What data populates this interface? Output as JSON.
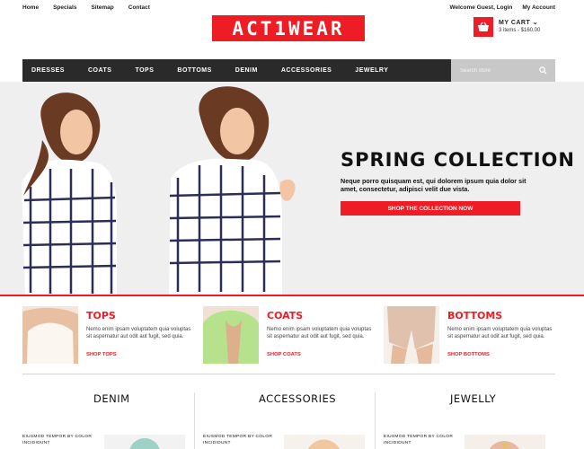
{
  "header": {
    "links": [
      "Home",
      "Specials",
      "Sitemap",
      "Contact"
    ],
    "account": [
      "Welcome Guest, Login",
      "My Account"
    ],
    "logo": "ACT1WEAR",
    "cart": {
      "title": "MY CART",
      "summary": "3 items - $160.00",
      "icon": "basket-icon"
    }
  },
  "nav": {
    "items": [
      "DRESSES",
      "COATS",
      "TOPS",
      "BOTTOMS",
      "DENIM",
      "ACCESSORIES",
      "JEWELRY"
    ],
    "search_placeholder": "Search store",
    "search_icon": "search-icon"
  },
  "hero": {
    "title": "SPRING COLLECTION",
    "text": "Neque porro quisquam est, qui dolorem ipsum quia dolor sit amet, consectetur, adipisci velit due vista.",
    "button": "SHOP THE COLLECTION NOW"
  },
  "categories": [
    {
      "title": "TOPS",
      "text": "Nemo enim ipsam voluptatem quia voluptas sit aspernatur aut odit aut fugit, sed quia.",
      "link": "SHOP TOPS"
    },
    {
      "title": "COATS",
      "text": "Nemo enim ipsam voluptatem quia voluptas sit aspernatur aut odit aut fugit, sed quia.",
      "link": "SHOP COATS"
    },
    {
      "title": "BOTTOMS",
      "text": "Nemo enim ipsam voluptatem quia voluptas sit aspernatur aut odit aut fugit, sed quia.",
      "link": "SHOP BOTTOMS"
    }
  ],
  "sections": [
    {
      "title": "DENIM",
      "promo": "EIUSMOD TEMPOR BY COLOR INCIDIDUNT"
    },
    {
      "title": "ACCESSORIES",
      "promo": "EIUSMOD TEMPOR BY COLOR INCIDIDUNT"
    },
    {
      "title": "JEWELLY",
      "promo": "EIUSMOD TEMPOR BY COLOR INCIDIDUNT"
    }
  ],
  "colors": {
    "accent": "#ee1c24",
    "nav": "#2a2a2a",
    "hero_background": "#efefef"
  }
}
